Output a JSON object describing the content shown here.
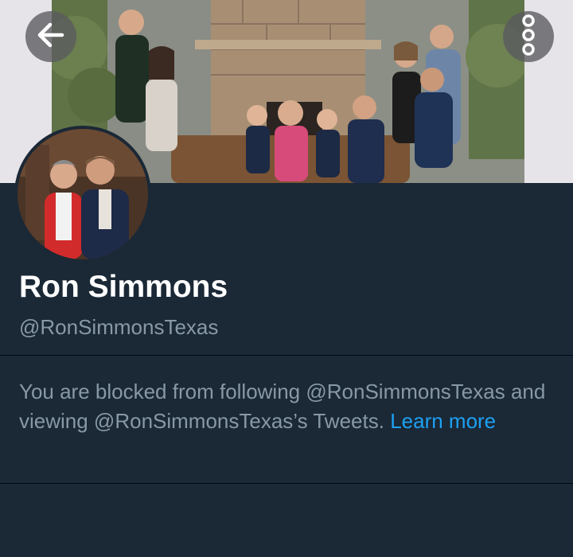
{
  "profile": {
    "name": "Ron Simmons",
    "handle": "@RonSimmonsTexas"
  },
  "icons": {
    "back": "arrow-left-icon",
    "more": "more-vertical-icon"
  },
  "blocked_notice": {
    "text": "You are blocked from following @RonSimmonsTexas and viewing @RonSimmonsTexas’s Tweets.",
    "link_text": "Learn more"
  },
  "colors": {
    "background": "#1b2836",
    "name_text": "#ffffff",
    "secondary_text": "#8899a6",
    "link": "#1da1f2",
    "divider": "#000a12"
  }
}
